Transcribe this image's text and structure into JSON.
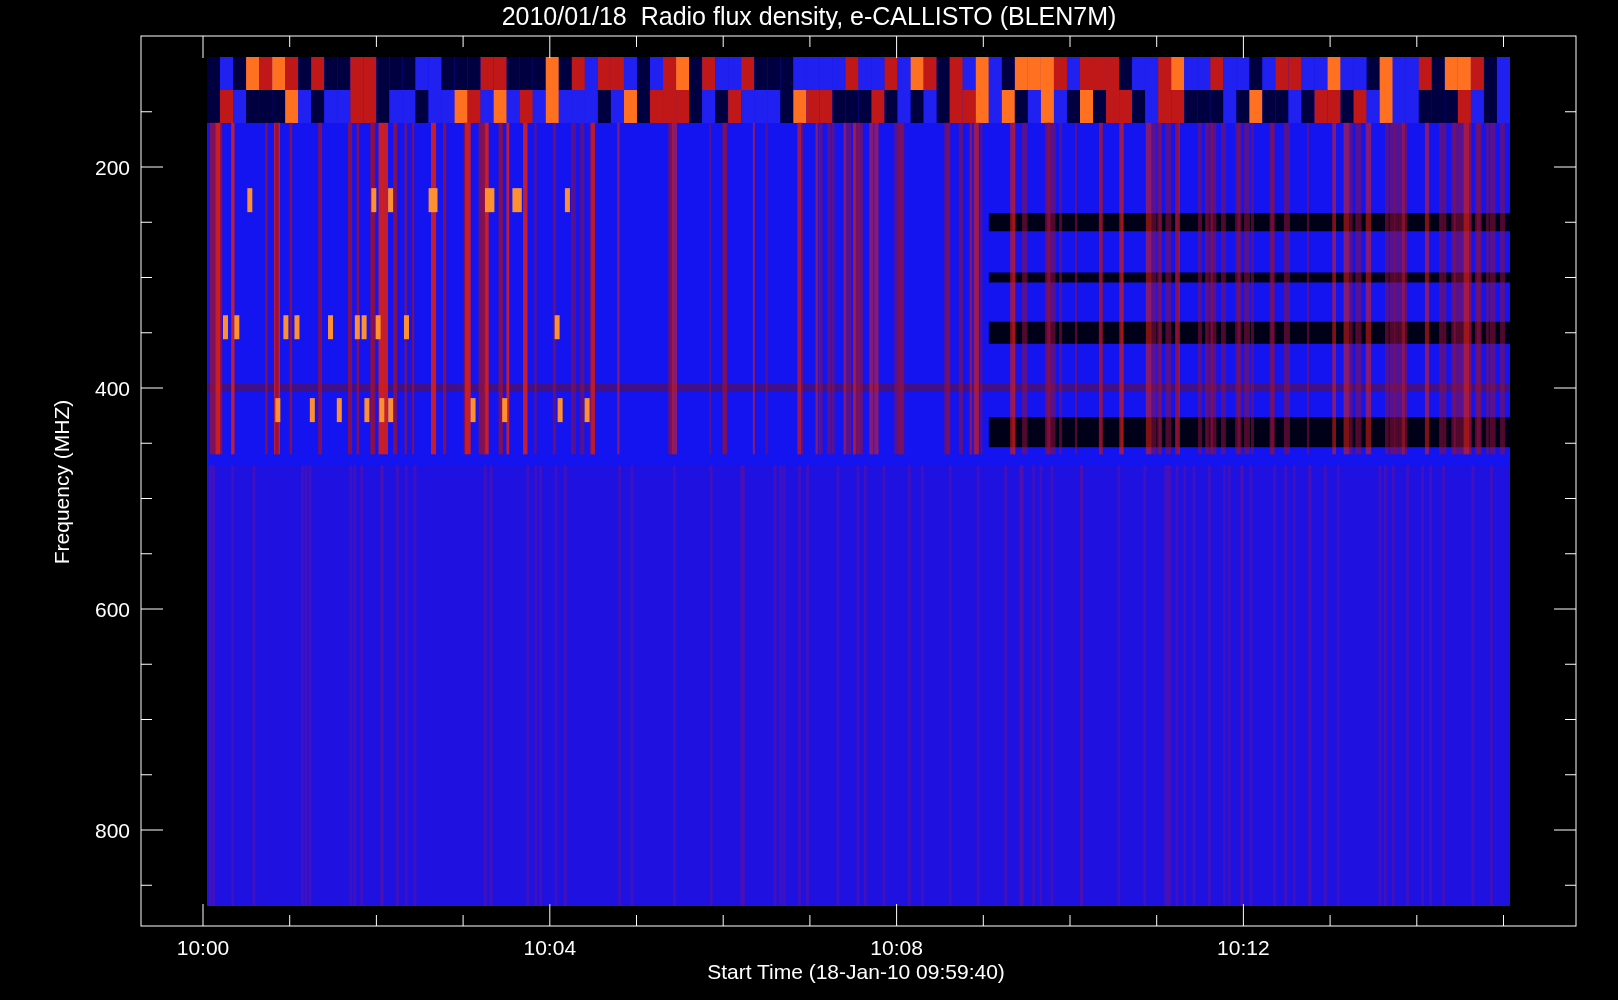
{
  "title": "2010/01/18  Radio flux density, e-CALLISTO (BLEN7M)",
  "y_axis": {
    "label": "Frequency (MHZ)",
    "tick_labels": [
      "200",
      "400",
      "600",
      "800"
    ]
  },
  "x_axis": {
    "label": "Start Time (18-Jan-10 09:59:40)",
    "tick_labels": [
      "10:00",
      "10:04",
      "10:08",
      "10:12"
    ]
  }
}
